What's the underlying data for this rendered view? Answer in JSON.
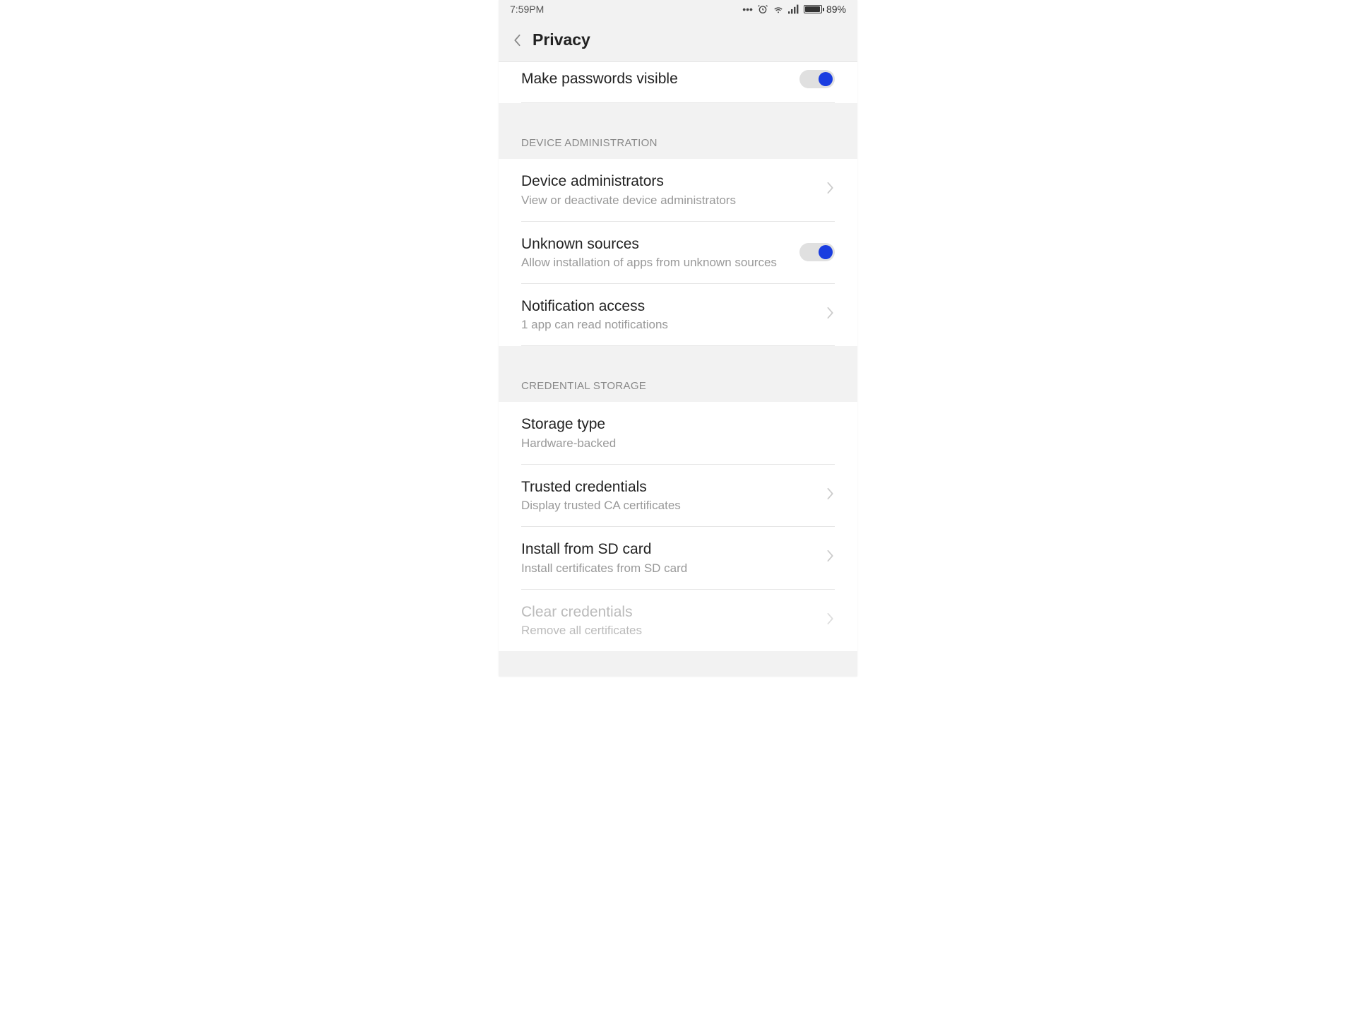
{
  "status": {
    "time": "7:59PM",
    "battery_pct": "89%"
  },
  "header": {
    "title": "Privacy"
  },
  "rows": {
    "passwords_visible": {
      "title": "Make passwords visible"
    },
    "device_admin_header": "DEVICE ADMINISTRATION",
    "device_admins": {
      "title": "Device administrators",
      "sub": "View or deactivate device administrators"
    },
    "unknown_sources": {
      "title": "Unknown sources",
      "sub": "Allow installation of apps from unknown sources"
    },
    "notification_access": {
      "title": "Notification access",
      "sub": "1 app can read notifications"
    },
    "credential_header": "CREDENTIAL STORAGE",
    "storage_type": {
      "title": "Storage type",
      "sub": "Hardware-backed"
    },
    "trusted_credentials": {
      "title": "Trusted credentials",
      "sub": "Display trusted CA certificates"
    },
    "install_sd": {
      "title": "Install from SD card",
      "sub": "Install certificates from SD card"
    },
    "clear_credentials": {
      "title": "Clear credentials",
      "sub": "Remove all certificates"
    }
  }
}
